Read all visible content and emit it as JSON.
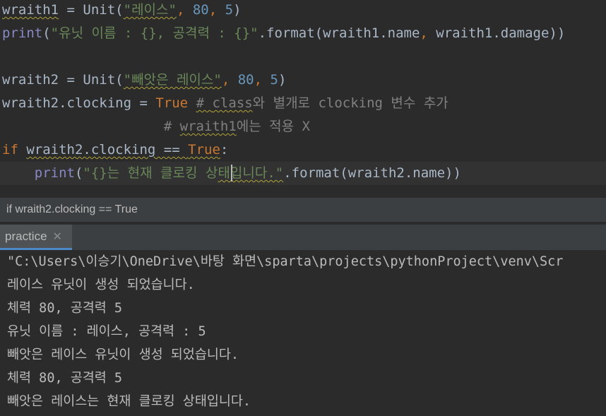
{
  "editor": {
    "line1": {
      "var": "wraith1",
      "eq": " = ",
      "cls": "Unit",
      "p1": "(",
      "s1": "\"레이스\"",
      "c1": ", ",
      "n1": "80",
      "c2": ", ",
      "n2": "5",
      "p2": ")"
    },
    "line2": {
      "fn": "print",
      "p1": "(",
      "s1": "\"유닛 이름 : {}, 공격력 : {}\"",
      "m": ".format(wraith1.name",
      "c": ", ",
      "m2": "wraith1.damage))"
    },
    "line3": {
      "var": "wraith2",
      "eq": " = ",
      "cls": "Unit",
      "p1": "(",
      "s1": "\"빼앗은 레이스\"",
      "c1": ", ",
      "n1": "80",
      "c2": ", ",
      "n2": "5",
      "p2": ")"
    },
    "line4": {
      "lhs": "wraith2.clocking",
      "eq": " = ",
      "kw": "True",
      "sp": " ",
      "cm1": "# ",
      "cm2": "class",
      "cm3": "와 별개로 clocking 변수 추가"
    },
    "line5": {
      "indent": "                    ",
      "cm1": "# ",
      "cm2": "wraith1",
      "cm3": "에는 적용 X"
    },
    "line6": {
      "kw": "if",
      "sp": " ",
      "cond": "wraith2.clocking == ",
      "kw2": "True",
      "colon": ":"
    },
    "line7": {
      "indent": "    ",
      "fn": "print",
      "p1": "(",
      "s1a": "\"{}는 현재 클로킹 상",
      "s1b": "태입니다.\"",
      "m": ".format(wraith2.name))"
    }
  },
  "breadcrumb": "if wraith2.clocking == True",
  "run_tab": {
    "label": "practice",
    "close": "✕"
  },
  "console": [
    "\"C:\\Users\\이승기\\OneDrive\\바탕 화면\\sparta\\projects\\pythonProject\\venv\\Scr",
    "레이스 유닛이 생성 되었습니다.",
    "체력 80, 공격력 5",
    "유닛 이름 : 레이스, 공격력 : 5",
    "빼앗은 레이스 유닛이 생성 되었습니다.",
    "체력 80, 공격력 5",
    "빼앗은 레이스는 현재 클로킹 상태입니다."
  ]
}
